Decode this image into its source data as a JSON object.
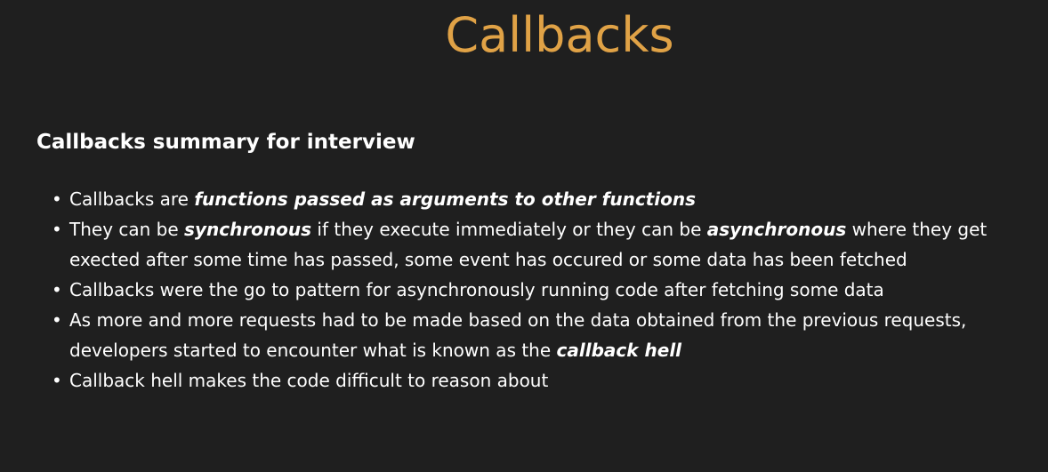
{
  "slide": {
    "title": "Callbacks",
    "heading": "Callbacks summary for interview",
    "bullet_char": "•",
    "bullets": [
      {
        "parts": [
          {
            "text": "Callbacks are ",
            "emph": false
          },
          {
            "text": "functions passed as arguments to other functions",
            "emph": true
          }
        ]
      },
      {
        "parts": [
          {
            "text": "They can be ",
            "emph": false
          },
          {
            "text": "synchronous",
            "emph": true
          },
          {
            "text": " if they execute immediately or they can be ",
            "emph": false
          },
          {
            "text": "asynchronous",
            "emph": true
          },
          {
            "text": " where they get exected after some time has passed, some event has occured or some data has been fetched",
            "emph": false
          }
        ]
      },
      {
        "parts": [
          {
            "text": "Callbacks were the go to pattern for asynchronously running code after fetching some data",
            "emph": false
          }
        ]
      },
      {
        "parts": [
          {
            "text": "As more and more requests had to be made based on the data obtained from the previous requests, developers started to encounter what is known as the ",
            "emph": false
          },
          {
            "text": "callback hell",
            "emph": true
          }
        ]
      },
      {
        "parts": [
          {
            "text": "Callback hell makes the code difficult to reason about",
            "emph": false
          }
        ]
      }
    ]
  },
  "colors": {
    "background": "#1f1f1f",
    "title": "#e0a246",
    "text": "#ffffff"
  }
}
